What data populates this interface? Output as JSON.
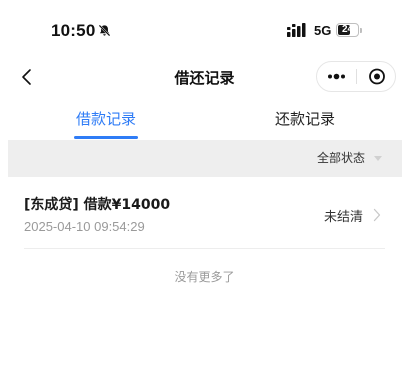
{
  "status_bar": {
    "time": "10:50",
    "network": "5G",
    "battery": "24",
    "battery_level": 0.24
  },
  "nav": {
    "title": "借还记录"
  },
  "tabs": [
    {
      "label": "借款记录",
      "active": true
    },
    {
      "label": "还款记录",
      "active": false
    }
  ],
  "filter": {
    "label": "全部状态"
  },
  "records": [
    {
      "title": "[东成贷] 借款¥14000",
      "time": "2025-04-10 09:54:29",
      "status": "未结清"
    }
  ],
  "footer": {
    "no_more": "没有更多了"
  },
  "colors": {
    "accent": "#2f7cf6",
    "filter_bg": "#eeeeee",
    "muted_text": "#9a9a9a"
  },
  "icons": [
    "bell-off-icon",
    "signal-icon",
    "battery-icon",
    "back-icon",
    "more-icon",
    "close-circle-icon",
    "caret-down-icon",
    "chevron-right-icon"
  ]
}
